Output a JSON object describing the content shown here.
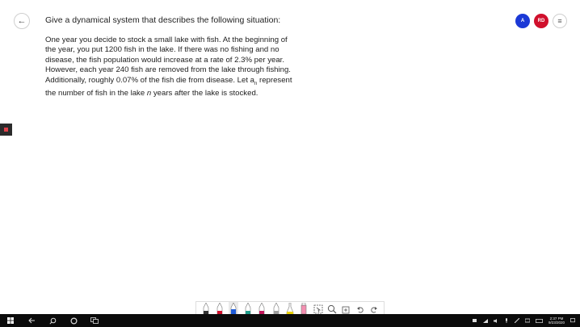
{
  "header": {
    "back_icon": "←",
    "title": "Give a dynamical system that describes the following situation:"
  },
  "problem": {
    "line1": "One year you decide to stock a small lake with fish. At the beginning of",
    "line2": "the year, you put 1200 fish in the lake.  If there was no fishing and no",
    "line3": "disease, the fish population would increase at a rate of 2.3% per year.",
    "line4": "However, each year 240 fish are removed from the lake through fishing.",
    "line5_prefix": "Additionally, roughly 0.07% of the fish die from disease. Let a",
    "line5_subscript": "n",
    "line5_suffix": " represent",
    "line6_prefix": "the number of fish in the lake ",
    "line6_variable": "n",
    "line6_suffix": " years after the lake is stocked."
  },
  "users": [
    {
      "initials": "A",
      "color": "#1b39d6"
    },
    {
      "initials": "RD",
      "color": "#d0102c"
    }
  ],
  "menu_icon": "≡",
  "toolbar": {
    "tools": [
      {
        "name": "pen-black",
        "color": "#333333"
      },
      {
        "name": "pen-red",
        "color": "#d0102c"
      },
      {
        "name": "pen-blue",
        "color": "#1e5bd8"
      },
      {
        "name": "pen-teal",
        "color": "#1f9c8a"
      },
      {
        "name": "pen-pink",
        "color": "#c2185b"
      },
      {
        "name": "pen-gray",
        "color": "#9e9e9e"
      },
      {
        "name": "highlighter-yellow",
        "color": "#e8d000"
      },
      {
        "name": "highlighter-pink",
        "color": "#f06292"
      }
    ]
  },
  "taskbar": {
    "time": "2:37 PM",
    "date": "9/23/2020"
  }
}
